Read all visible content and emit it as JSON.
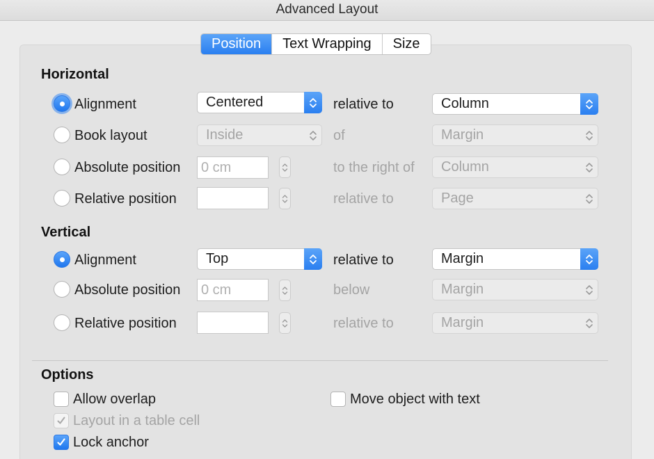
{
  "window": {
    "title": "Advanced Layout"
  },
  "tabs": [
    {
      "label": "Position",
      "active": true
    },
    {
      "label": "Text Wrapping",
      "active": false
    },
    {
      "label": "Size",
      "active": false
    }
  ],
  "horizontal": {
    "title": "Horizontal",
    "alignment": {
      "label": "Alignment",
      "value": "Centered",
      "relative_label": "relative to",
      "relative_value": "Column"
    },
    "book_layout": {
      "label": "Book layout",
      "value": "Inside",
      "relative_label": "of",
      "relative_value": "Margin"
    },
    "absolute_position": {
      "label": "Absolute position",
      "placeholder": "0 cm",
      "relative_label": "to the right of",
      "relative_value": "Column"
    },
    "relative_position": {
      "label": "Relative position",
      "value": "",
      "relative_label": "relative to",
      "relative_value": "Page"
    }
  },
  "vertical": {
    "title": "Vertical",
    "alignment": {
      "label": "Alignment",
      "value": "Top",
      "relative_label": "relative to",
      "relative_value": "Margin"
    },
    "absolute_position": {
      "label": "Absolute position",
      "placeholder": "0 cm",
      "relative_label": "below",
      "relative_value": "Margin"
    },
    "relative_position": {
      "label": "Relative position",
      "value": "",
      "relative_label": "relative to",
      "relative_value": "Margin"
    }
  },
  "options": {
    "title": "Options",
    "allow_overlap": {
      "label": "Allow overlap",
      "checked": false
    },
    "move_object_with_text": {
      "label": "Move object with text",
      "checked": false
    },
    "layout_in_table_cell": {
      "label": "Layout in a table cell",
      "checked": true,
      "enabled": false
    },
    "lock_anchor": {
      "label": "Lock anchor",
      "checked": true
    }
  },
  "colors": {
    "accent": "#2a7ff0",
    "disabled_text": "#a4a4a4",
    "background": "#ececec"
  },
  "icons": {
    "popup": "updown-chevron-icon",
    "stepper": "stepper-arrows-icon",
    "check": "checkmark-icon"
  }
}
